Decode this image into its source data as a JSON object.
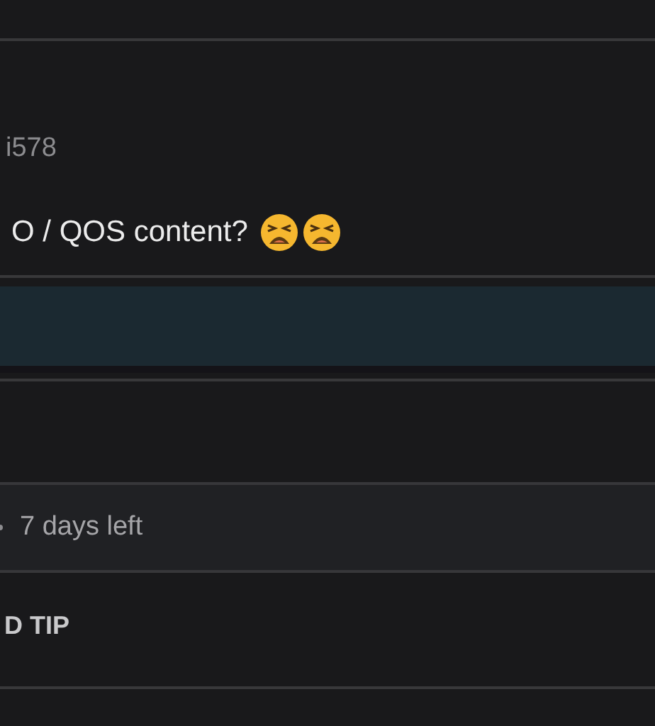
{
  "comment": {
    "author": "i578",
    "text": "O / QOS content?",
    "emojis": [
      {
        "kind": "weary-face"
      },
      {
        "kind": "weary-face"
      }
    ]
  },
  "countdown": {
    "text": "7 days left"
  },
  "action": {
    "label": "D TIP"
  }
}
